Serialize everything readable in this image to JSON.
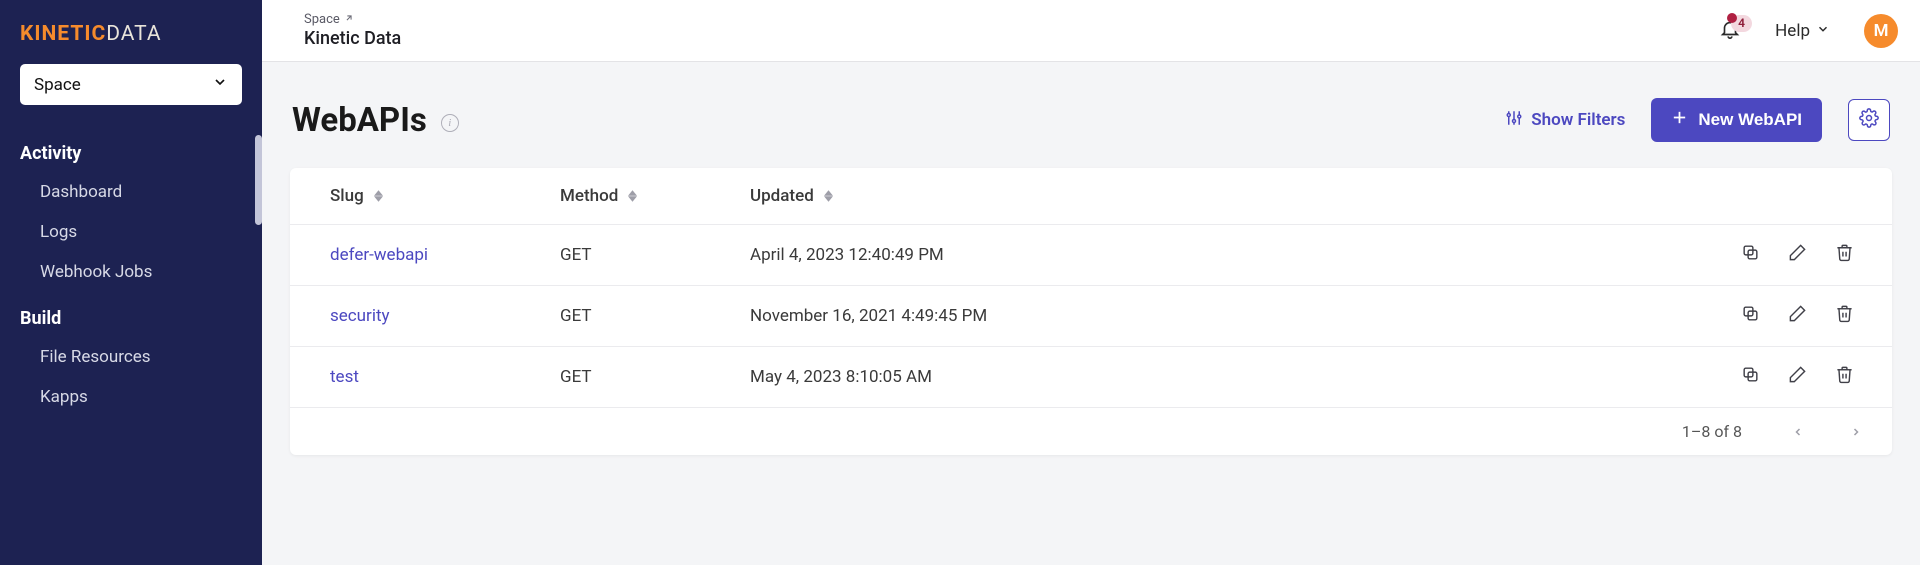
{
  "brand": {
    "part1": "KINETIC",
    "part2": "DATA"
  },
  "sidebar": {
    "space_selector_label": "Space",
    "sections": [
      {
        "title": "Activity",
        "items": [
          "Dashboard",
          "Logs",
          "Webhook Jobs"
        ]
      },
      {
        "title": "Build",
        "items": [
          "File Resources",
          "Kapps"
        ]
      }
    ]
  },
  "header": {
    "breadcrumb_label": "Space",
    "title": "Kinetic Data",
    "notification_count": "4",
    "help_label": "Help",
    "avatar_initial": "M"
  },
  "page": {
    "title": "WebAPIs",
    "filters_label": "Show Filters",
    "new_button_label": "New WebAPI"
  },
  "table": {
    "columns": [
      "Slug",
      "Method",
      "Updated"
    ],
    "rows": [
      {
        "slug": "defer-webapi",
        "method": "GET",
        "updated": "April 4, 2023 12:40:49 PM"
      },
      {
        "slug": "security",
        "method": "GET",
        "updated": "November 16, 2021 4:49:45 PM"
      },
      {
        "slug": "test",
        "method": "GET",
        "updated": "May 4, 2023 8:10:05 AM"
      }
    ],
    "range_text": "1–8 of 8"
  }
}
